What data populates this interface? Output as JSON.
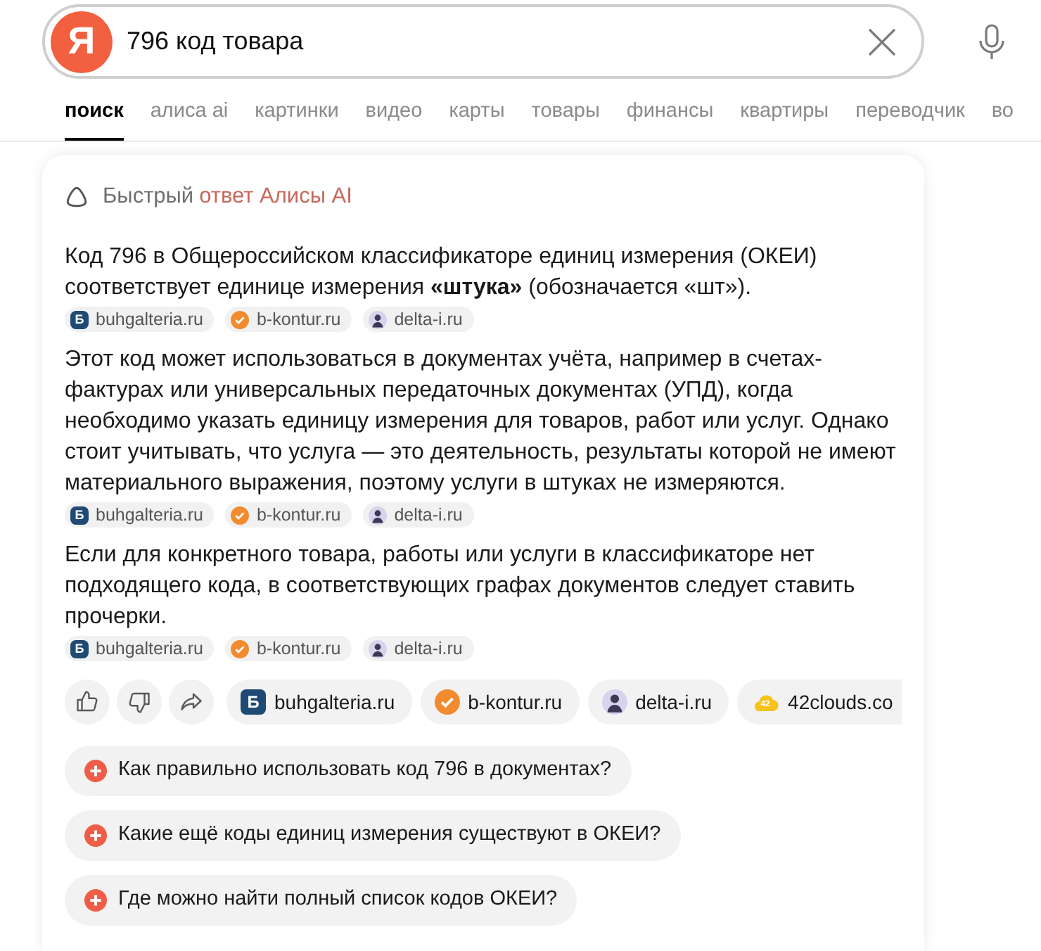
{
  "search": {
    "logo": "Я",
    "query": "796 код товара"
  },
  "tabs": [
    {
      "label": "поиск",
      "selected": true
    },
    {
      "label": "алиса ai",
      "selected": false
    },
    {
      "label": "картинки",
      "selected": false
    },
    {
      "label": "видео",
      "selected": false
    },
    {
      "label": "карты",
      "selected": false
    },
    {
      "label": "товары",
      "selected": false
    },
    {
      "label": "финансы",
      "selected": false
    },
    {
      "label": "квартиры",
      "selected": false
    },
    {
      "label": "переводчик",
      "selected": false
    },
    {
      "label": "во",
      "selected": false
    }
  ],
  "answer": {
    "header": {
      "prefix": "Быстрый",
      "highlight": "ответ Алисы AI"
    },
    "paragraphs": [
      {
        "text": "Код 796 в Общероссийском классификаторе единиц измерения (ОКЕИ) соответствует единице измерения **«штука»** (обозначается «шт»).",
        "sources": [
          {
            "kind": "letter",
            "logo": "Б",
            "label": "buhgalteria.ru"
          },
          {
            "kind": "check",
            "label": "b-kontur.ru"
          },
          {
            "kind": "avatar",
            "label": "delta-i.ru"
          }
        ]
      },
      {
        "text": "Этот код может использоваться в документах учёта, например в счетах-фактурах или универсальных передаточных документах (УПД), когда необходимо указать единицу измерения для товаров, работ или услуг. Однако стоит учитывать, что услуга — это деятельность, результаты которой не имеют материального выражения, поэтому услуги в штуках не измеряются.",
        "sources": [
          {
            "kind": "letter",
            "logo": "Б",
            "label": "buhgalteria.ru"
          },
          {
            "kind": "check",
            "label": "b-kontur.ru"
          },
          {
            "kind": "avatar",
            "label": "delta-i.ru"
          }
        ]
      },
      {
        "text": "Если для конкретного товара, работы или услуги в классификаторе нет подходящего кода, в соответствующих графах документов следует ставить прочерки.",
        "sources": [
          {
            "kind": "letter",
            "logo": "Б",
            "label": "buhgalteria.ru"
          },
          {
            "kind": "check",
            "label": "b-kontur.ru"
          },
          {
            "kind": "avatar",
            "label": "delta-i.ru"
          }
        ]
      }
    ],
    "actions": [
      {
        "kind": "like"
      },
      {
        "kind": "dislike"
      },
      {
        "kind": "share"
      }
    ],
    "sources": [
      {
        "kind": "letter",
        "logo": "Б",
        "label": "buhgalteria.ru"
      },
      {
        "kind": "check",
        "label": "b-kontur.ru"
      },
      {
        "kind": "avatar",
        "label": "delta-i.ru"
      },
      {
        "kind": "cloud",
        "logo": "42",
        "label": "42clouds.co"
      }
    ],
    "follow_up_questions": [
      "Как правильно использовать код 796 в документах?",
      "Какие ещё коды единиц измерения существуют в ОКЕИ?",
      "Где можно найти полный список кодов ОКЕИ?"
    ]
  }
}
